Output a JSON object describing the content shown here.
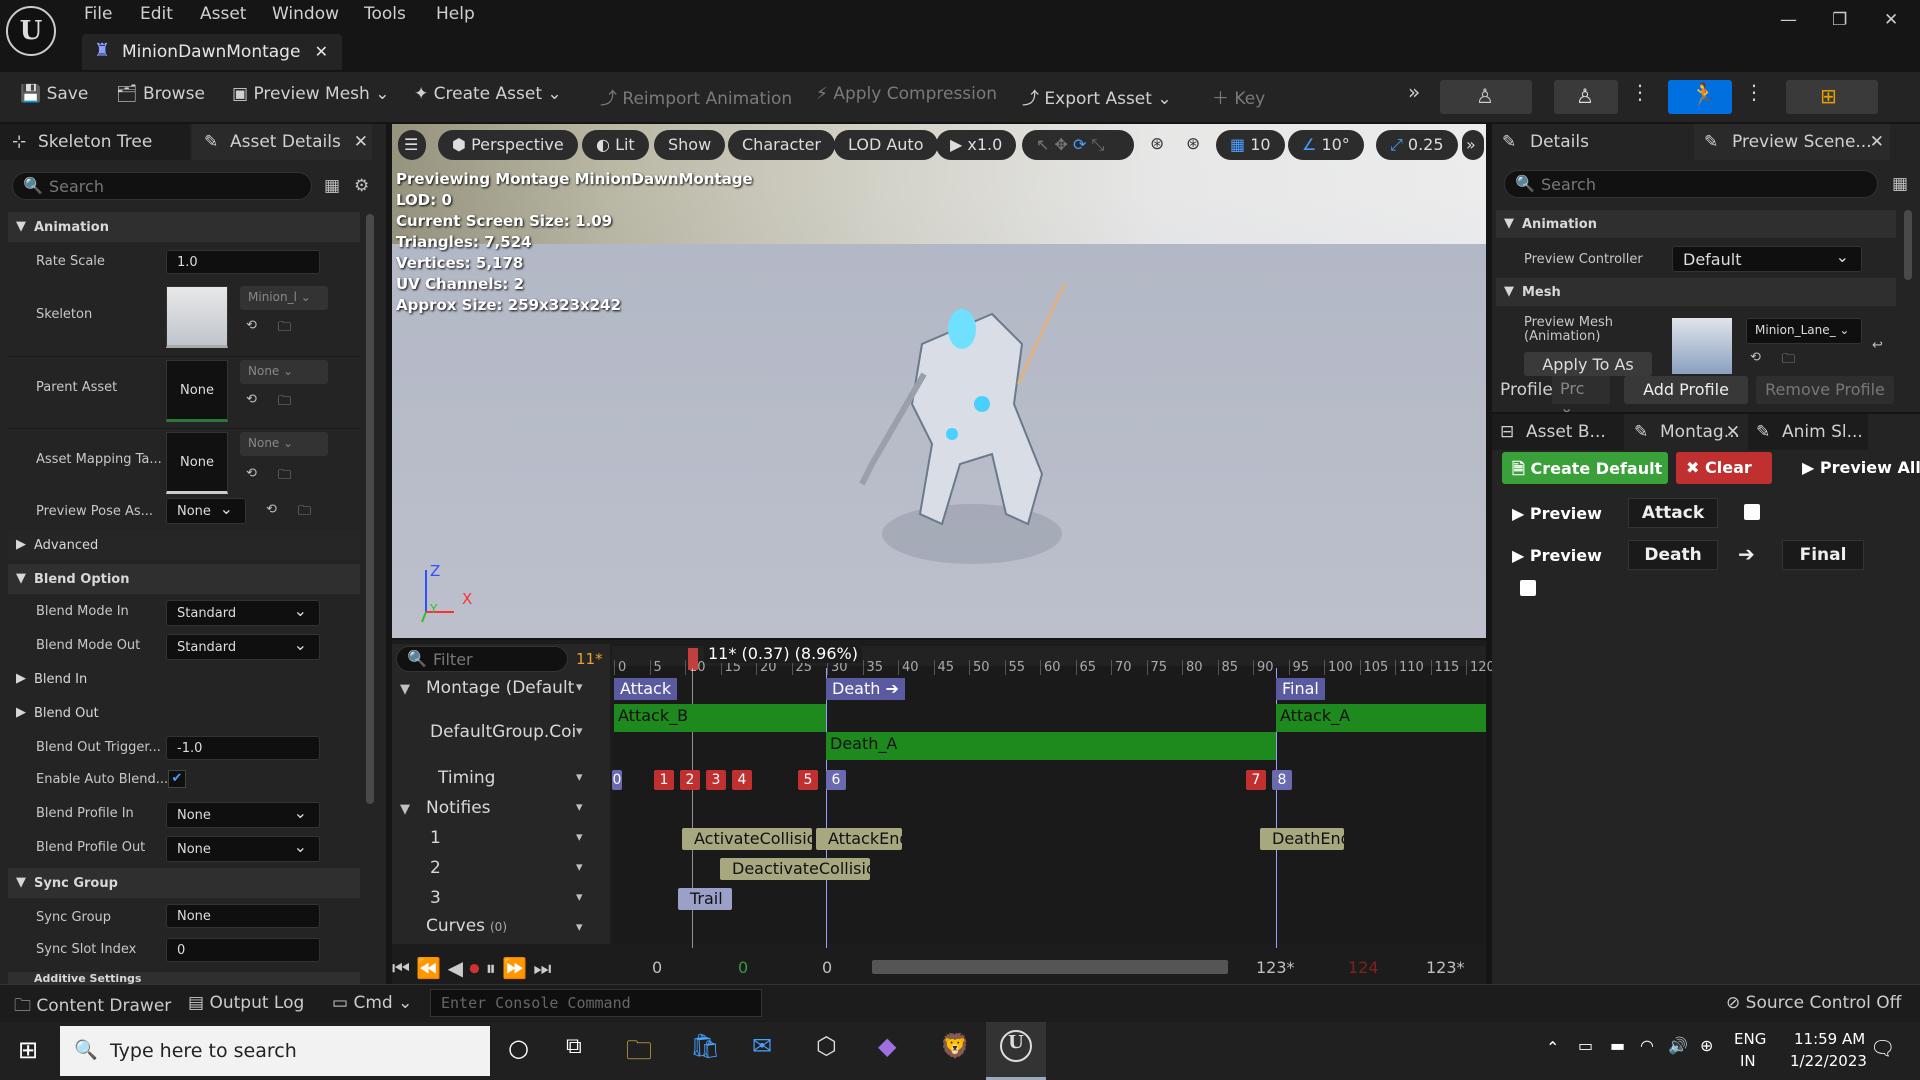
{
  "app": {
    "menu": [
      "File",
      "Edit",
      "Asset",
      "Window",
      "Tools",
      "Help"
    ],
    "doc_tab": "MinionDawnMontage",
    "window_buttons": {
      "minimize": "—",
      "maximize": "❐",
      "close": "✕"
    }
  },
  "toolbar": {
    "save": "Save",
    "browse": "Browse",
    "preview_mesh": "Preview Mesh",
    "create_asset": "Create Asset",
    "reimport": "Reimport Animation",
    "apply_compression": "Apply Compression",
    "export_asset": "Export Asset",
    "key": "Key"
  },
  "left": {
    "tabs": {
      "skeleton_tree": "Skeleton Tree",
      "asset_details": "Asset Details"
    },
    "search_placeholder": "Search",
    "sections": {
      "animation": "Animation",
      "advanced": "Advanced",
      "blend_option": "Blend Option",
      "blend_in": "Blend In",
      "blend_out": "Blend Out",
      "sync_group": "Sync Group",
      "additive": "Additive Settings"
    },
    "rows": {
      "rate_scale": {
        "label": "Rate Scale",
        "value": "1.0"
      },
      "skeleton": {
        "label": "Skeleton",
        "value": "Minion_l"
      },
      "parent_asset": {
        "label": "Parent Asset",
        "thumb": "None",
        "combo": "None"
      },
      "asset_mapping": {
        "label": "Asset Mapping Ta...",
        "thumb": "None",
        "combo": "None"
      },
      "preview_pose": {
        "label": "Preview Pose As...",
        "value": "None"
      },
      "blend_mode_in": {
        "label": "Blend Mode In",
        "value": "Standard"
      },
      "blend_mode_out": {
        "label": "Blend Mode Out",
        "value": "Standard"
      },
      "blend_out_trigger": {
        "label": "Blend Out Trigger...",
        "value": "-1.0"
      },
      "enable_auto_blend": {
        "label": "Enable Auto Blend...",
        "checked": true
      },
      "blend_profile_in": {
        "label": "Blend Profile In",
        "value": "None"
      },
      "blend_profile_out": {
        "label": "Blend Profile Out",
        "value": "None"
      },
      "sync_group": {
        "label": "Sync Group",
        "value": "None"
      },
      "sync_slot_index": {
        "label": "Sync Slot Index",
        "value": "0"
      }
    }
  },
  "viewport": {
    "buttons": {
      "perspective": "Perspective",
      "lit": "Lit",
      "show": "Show",
      "character": "Character",
      "lod": "LOD Auto",
      "speed": "x1.0",
      "grid": "10",
      "angle": "10°",
      "scale": "0.25"
    },
    "overlay": [
      "Previewing Montage MinionDawnMontage",
      "LOD: 0",
      "Current Screen Size: 1.09",
      "Triangles: 7,524",
      "Vertices: 5,178",
      "UV Channels: 2",
      "Approx Size: 259x323x242"
    ],
    "axis": {
      "z": "Z",
      "x": "X",
      "y": "Y"
    }
  },
  "timeline": {
    "filter_placeholder": "Filter",
    "frame_badge": "11*",
    "playhead_label": "11* (0.37) (8.96%)",
    "ticks": [
      "0",
      "5",
      "10",
      "15",
      "20",
      "25",
      "30",
      "35",
      "40",
      "45",
      "50",
      "55",
      "60",
      "65",
      "70",
      "75",
      "80",
      "85",
      "90",
      "95",
      "100",
      "105",
      "110",
      "115",
      "120"
    ],
    "tracks": {
      "montage": "Montage (Default",
      "group": "DefaultGroup.Coi",
      "timing": "Timing",
      "notifies": "Notifies",
      "n1": "1",
      "n2": "2",
      "n3": "3",
      "curves": "Curves",
      "curves_count": "(0)"
    },
    "sections": {
      "attack": "Attack",
      "death": "Death",
      "final": "Final"
    },
    "segments": {
      "attack_b": "Attack_B",
      "death_a": "Death_A",
      "attack_a": "Attack_A"
    },
    "timing_markers": [
      "0",
      "1",
      "2",
      "3",
      "4",
      "5",
      "6",
      "7",
      "8"
    ],
    "notifies": {
      "activate": "ActivateCollisio",
      "attack_end": "AttackEnd",
      "deactivate": "DeactivateCollisio",
      "trail": "Trail",
      "death_end": "DeathEnd"
    },
    "transport_values": {
      "a": "0",
      "b": "0",
      "c": "0",
      "end1": "123*",
      "end2": "124",
      "end3": "123*"
    }
  },
  "right": {
    "tabs": {
      "details": "Details",
      "preview_scene": "Preview Scene..."
    },
    "search_placeholder": "Search",
    "sections": {
      "animation": "Animation",
      "mesh": "Mesh"
    },
    "preview_controller": {
      "label": "Preview Controller",
      "value": "Default"
    },
    "preview_mesh": {
      "label": "Preview Mesh (Animation)",
      "value": "Minion_Lane_"
    },
    "apply_to_as": "Apply To As",
    "profile_label": "Profile",
    "profile_value": "Prc",
    "add_profile": "Add Profile",
    "remove_profile": "Remove Profile",
    "bottom_tabs": {
      "asset_browser": "Asset B...",
      "montage": "Montag...",
      "anim_slot": "Anim Sl..."
    },
    "create_default": "Create Default",
    "clear": "Clear",
    "preview_all": "Preview All",
    "preview": "Preview",
    "slot_attack": "Attack",
    "slot_death": "Death",
    "slot_final": "Final"
  },
  "statusbar": {
    "content_drawer": "Content Drawer",
    "output_log": "Output Log",
    "cmd": "Cmd",
    "console_placeholder": "Enter Console Command",
    "source_control": "Source Control Off"
  },
  "taskbar": {
    "search_placeholder": "Type here to search",
    "lang1": "ENG",
    "lang2": "IN",
    "time": "11:59 AM",
    "date": "1/22/2023"
  },
  "colors": {
    "accent": "#0070e0",
    "green_track": "#1e8a1e",
    "section": "#5a5aa0",
    "timing_red": "#c03030",
    "create_default": "#3aa03a",
    "clear": "#c03030"
  }
}
